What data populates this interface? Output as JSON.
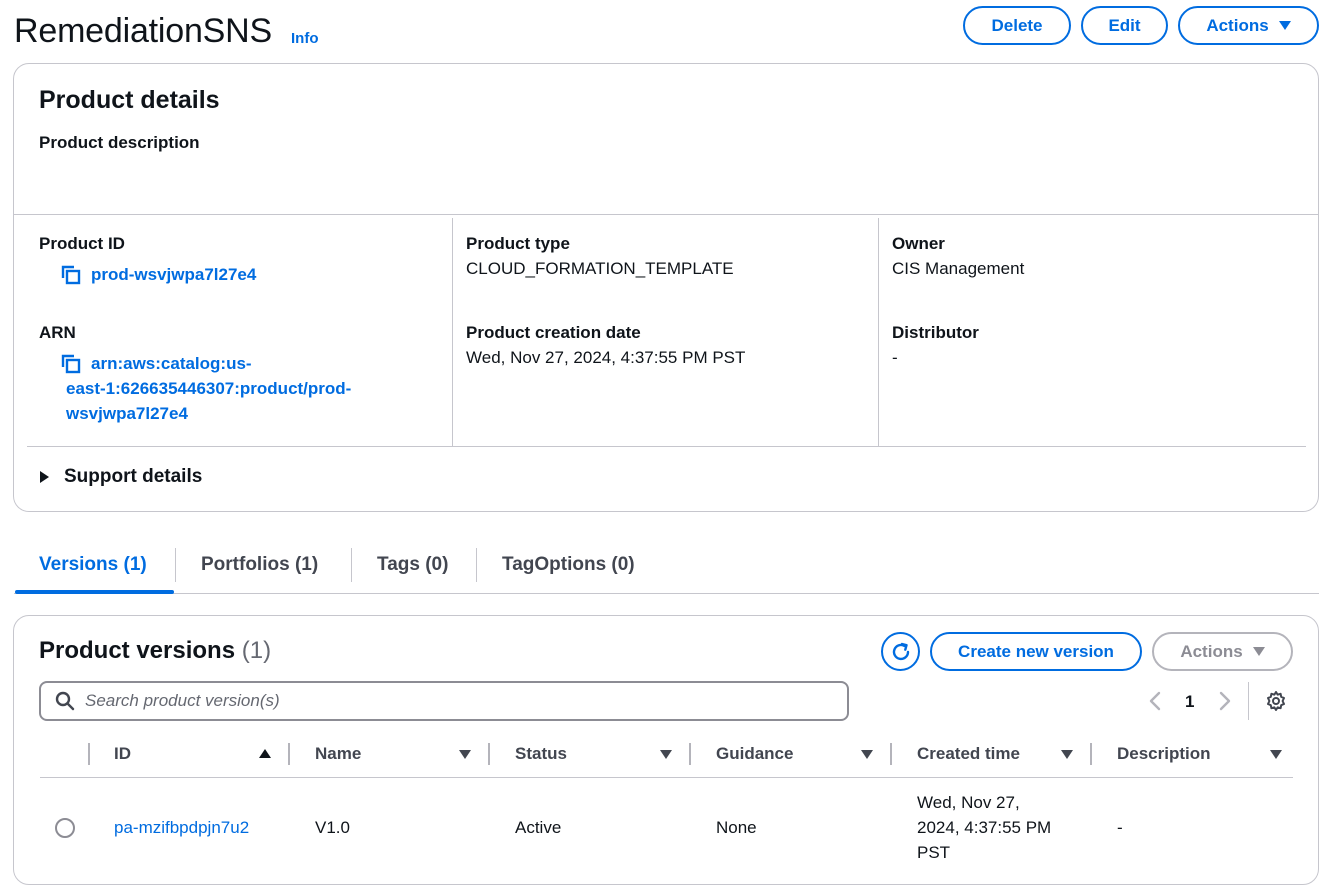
{
  "header": {
    "title": "RemediationSNS",
    "info": "Info",
    "delete_label": "Delete",
    "edit_label": "Edit",
    "actions_label": "Actions"
  },
  "details": {
    "heading": "Product details",
    "description_label": "Product description",
    "product_id_label": "Product ID",
    "product_id": "prod-wsvjwpa7l27e4",
    "arn_label": "ARN",
    "arn_line1": "arn:aws:catalog:us-",
    "arn_line2": "east-1:626635446307:product/prod-",
    "arn_line3": "wsvjwpa7l27e4",
    "type_label": "Product type",
    "type": "CLOUD_FORMATION_TEMPLATE",
    "creation_label": "Product creation date",
    "creation": "Wed, Nov 27, 2024, 4:37:55 PM PST",
    "owner_label": "Owner",
    "owner": "CIS Management",
    "distributor_label": "Distributor",
    "distributor": "-",
    "support_label": "Support details"
  },
  "tabs": [
    {
      "label": "Versions (1)"
    },
    {
      "label": "Portfolios (1)"
    },
    {
      "label": "Tags (0)"
    },
    {
      "label": "TagOptions (0)"
    }
  ],
  "versions": {
    "heading": "Product versions",
    "count": "(1)",
    "create_label": "Create new version",
    "actions_label": "Actions",
    "search_placeholder": "Search product version(s)",
    "page": "1",
    "columns": [
      "ID",
      "Name",
      "Status",
      "Guidance",
      "Created time",
      "Description"
    ],
    "rows": [
      {
        "id": "pa-mzifbpdpjn7u2",
        "name": "V1.0",
        "status": "Active",
        "guidance": "None",
        "created_line1": "Wed, Nov 27,",
        "created_line2": "2024, 4:37:55 PM",
        "created_line3": "PST",
        "description": "-"
      }
    ]
  },
  "colors": {
    "accent": "#006ce0",
    "border": "#c6c6cd",
    "text": "#0f141a"
  }
}
